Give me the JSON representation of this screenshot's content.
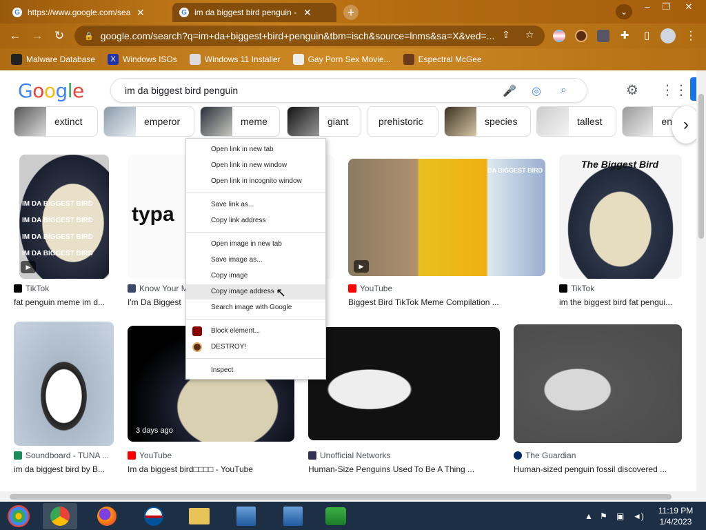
{
  "tabs": [
    {
      "title": "https://www.google.com/search?q=",
      "active": false
    },
    {
      "title": "im da biggest bird penguin - Goog",
      "active": true
    }
  ],
  "window": {
    "new_tab": "+",
    "minimize": "‒",
    "restore": "❐",
    "close": "✕"
  },
  "address": {
    "url": "google.com/search?q=im+da+biggest+bird+penguin&tbm=isch&source=lnms&sa=X&ved=..."
  },
  "bookmarks": [
    "Malware Database",
    "Windows ISOs",
    "Windows 11 Installer",
    "Gay Porn Sex Movie...",
    "Espectral McGee"
  ],
  "search": {
    "logo": "Google",
    "query": "im da biggest bird penguin"
  },
  "chips": [
    "extinct",
    "emperor",
    "meme",
    "giant",
    "prehistoric",
    "species",
    "tallest",
    "en"
  ],
  "results_row1": [
    {
      "source": "TikTok",
      "title": "fat penguin meme im d...",
      "overlay": "IM DA BIGGEST BIRD"
    },
    {
      "source": "Know Your M",
      "title": "I'm Da Biggest",
      "overlay": "typa"
    },
    {
      "source": "YouTube",
      "title": "Biggest Bird TikTok Meme Compilation ...",
      "overlay": "DA BIGGEST BIRD"
    },
    {
      "source": "TikTok",
      "title": "im the biggest bird fat pengui...",
      "overlay": "The Biggest Bird"
    }
  ],
  "results_row2": [
    {
      "source": "Soundboard - TUNA ...",
      "title": "im da biggest bird by B..."
    },
    {
      "source": "YouTube",
      "title": "Im da biggest bird□□□□ - YouTube",
      "badge": "3 days ago"
    },
    {
      "source": "Unofficial Networks",
      "title": "Human-Size Penguins Used To Be A Thing ..."
    },
    {
      "source": "The Guardian",
      "title": "Human-sized penguin fossil discovered ..."
    }
  ],
  "context_menu": [
    "Open link in new tab",
    "Open link in new window",
    "Open link in incognito window",
    "Save link as...",
    "Copy link address",
    "Open image in new tab",
    "Save image as...",
    "Copy image",
    "Copy image address",
    "Search image with Google",
    "Block element...",
    "DESTROY!",
    "Inspect"
  ],
  "clock": {
    "time": "11:19 PM",
    "date": "1/4/2023"
  },
  "colors": {
    "google_blue": "#4285f4",
    "google_red": "#ea4335",
    "google_yellow": "#fbbc05",
    "google_green": "#34a853"
  }
}
